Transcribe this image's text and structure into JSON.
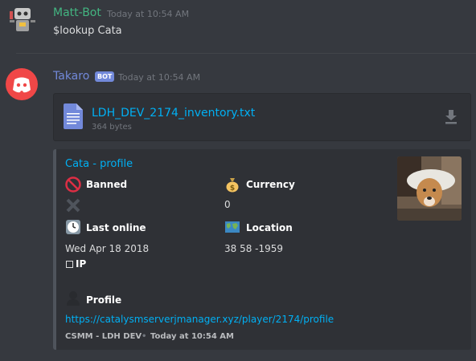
{
  "messages": [
    {
      "author": "Matt-Bot",
      "author_color": "#43b581",
      "timestamp": "Today at 10:54 AM",
      "text": "$lookup Cata"
    },
    {
      "author": "Takaro",
      "author_color": "#7289da",
      "bot_tag": "BOT",
      "timestamp": "Today at 10:54 AM",
      "attachment": {
        "filename": "LDH_DEV_2174_inventory.txt",
        "size": "364 bytes"
      },
      "embed": {
        "title": "Cata - profile",
        "fields": {
          "banned": {
            "name": "Banned",
            "value_icon": "cross-icon"
          },
          "currency": {
            "name": "Currency",
            "value": "0"
          },
          "last_online": {
            "name": "Last online",
            "value": "Wed Apr 18 2018"
          },
          "location": {
            "name": "Location",
            "value": "38 58 -1959"
          },
          "ip": {
            "name": "IP"
          },
          "profile": {
            "name": "Profile",
            "value": "https://catalysmserverjmanager.xyz/player/2174/profile"
          }
        },
        "footer": {
          "text": "CSMM - LDH DEV",
          "separator": "•",
          "timestamp": "Today at 10:54 AM"
        }
      }
    }
  ],
  "colors": {
    "background": "#36393f",
    "embed_bg": "#2f3136",
    "link": "#00b0f4",
    "bot_tag": "#7289da"
  }
}
